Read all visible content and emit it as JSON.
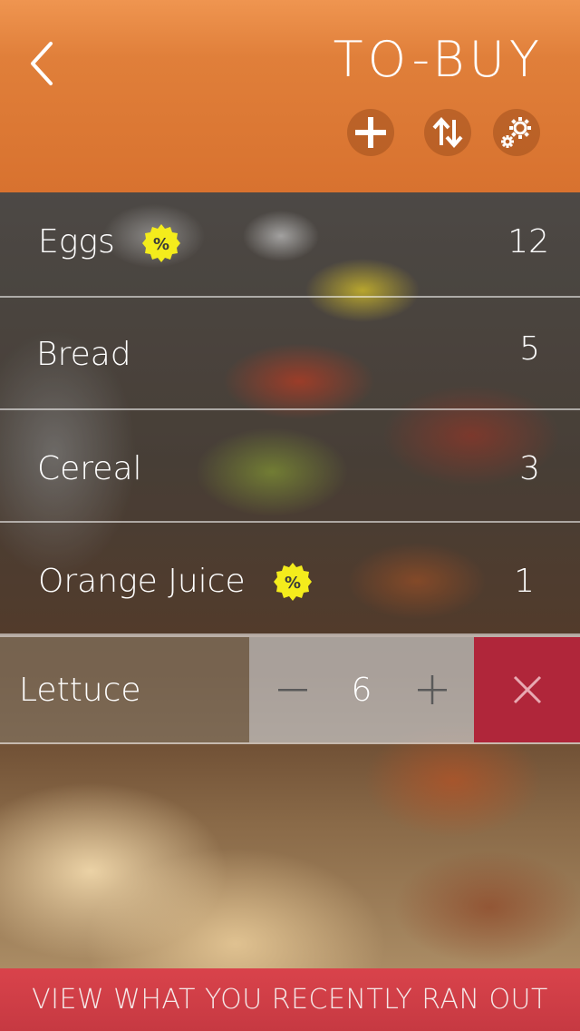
{
  "header": {
    "title": "TO-BUY",
    "back_icon": "chevron-left-icon",
    "actions": [
      {
        "name": "add",
        "icon": "plus-icon"
      },
      {
        "name": "sort",
        "icon": "sort-arrows-icon"
      },
      {
        "name": "settings",
        "icon": "gears-icon"
      }
    ],
    "color": "#e07f3a"
  },
  "items": [
    {
      "label": "Eggs",
      "qty": "12",
      "discount": true,
      "discount_symbol": "%"
    },
    {
      "label": "Bread",
      "qty": "5",
      "discount": false
    },
    {
      "label": "Cereal",
      "qty": "3",
      "discount": false
    },
    {
      "label": "Orange Juice",
      "qty": "1",
      "discount": true,
      "discount_symbol": "%"
    }
  ],
  "editing_item": {
    "label": "Lettuce",
    "qty": "6",
    "decrement_icon": "minus-icon",
    "increment_icon": "plus-icon",
    "delete_icon": "close-icon",
    "delete_color": "#b0263a"
  },
  "footer": {
    "label": "VIEW WHAT YOU RECENTLY RAN OUT",
    "color": "#d9434b"
  },
  "discount_badge_color": "#f4ec1c"
}
